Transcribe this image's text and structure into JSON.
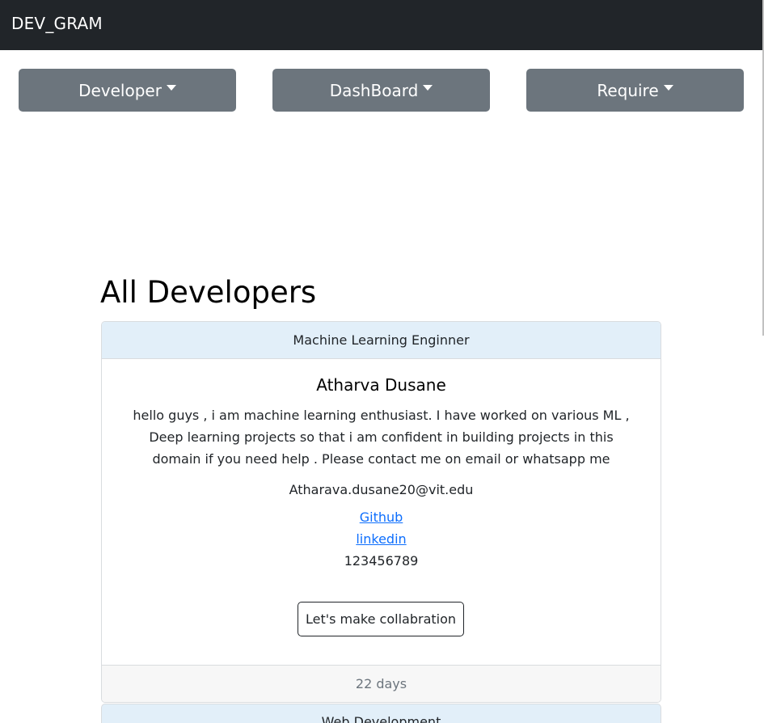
{
  "navbar": {
    "brand": "DEV_GRAM"
  },
  "menus": [
    {
      "label": "Developer"
    },
    {
      "label": "DashBoard"
    },
    {
      "label": "Require"
    }
  ],
  "main": {
    "heading": "All Developers",
    "cards": [
      {
        "category": "Machine Learning Enginner",
        "name": "Atharva Dusane",
        "bio": "hello guys , i am machine learning enthusiast. I have worked on various ML , Deep learning projects so that i am confident in building projects in this domain if you need help . Please contact me on email or whatsapp me",
        "email": "Atharava.dusane20@vit.edu",
        "github_label": "Github",
        "linkedin_label": "linkedin",
        "phone": "123456789",
        "action_label": "Let's make collabration",
        "age": "22 days"
      },
      {
        "category": "Web Development"
      }
    ]
  },
  "colors": {
    "navbar_bg": "#212529",
    "button_bg": "#6c757d",
    "card_header_bg": "#e2eff9",
    "link": "#0d6efd"
  }
}
